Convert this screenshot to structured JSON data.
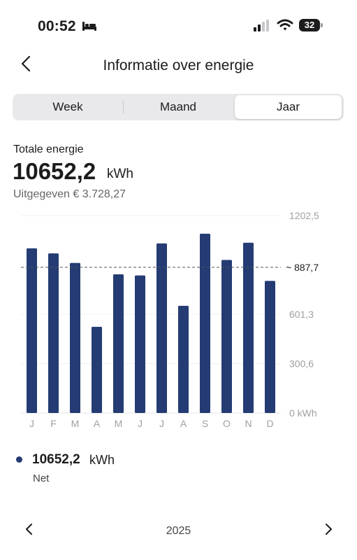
{
  "status_bar": {
    "time": "00:52",
    "battery": "32"
  },
  "nav": {
    "title": "Informatie over energie"
  },
  "tabs": [
    {
      "label": "Week",
      "selected": false
    },
    {
      "label": "Maand",
      "selected": false
    },
    {
      "label": "Jaar",
      "selected": true
    }
  ],
  "summary": {
    "label": "Totale energie",
    "value": "10652,2",
    "unit": "kWh",
    "spent": "Uitgegeven € 3.728,27"
  },
  "chart_data": {
    "type": "bar",
    "categories": [
      "J",
      "F",
      "M",
      "A",
      "M",
      "J",
      "J",
      "A",
      "S",
      "O",
      "N",
      "D"
    ],
    "values": [
      1003,
      972,
      914,
      525,
      845,
      838,
      1033,
      653,
      1092,
      932,
      1037,
      805
    ],
    "ylim": [
      0,
      1202.5
    ],
    "y_ticks": [
      {
        "value": 1202.5,
        "label": "1202,5"
      },
      {
        "value": 601.3,
        "label": "601,3"
      },
      {
        "value": 300.6,
        "label": "300,6"
      },
      {
        "value": 0,
        "label": "0 kWh"
      }
    ],
    "average": {
      "value": 887.7,
      "label": "~ 887,7"
    },
    "bar_color": "#243c73",
    "grid": true
  },
  "legend": {
    "value": "10652,2",
    "unit": "kWh",
    "label": "Net",
    "color": "#243c73"
  },
  "footer": {
    "year": "2025"
  }
}
